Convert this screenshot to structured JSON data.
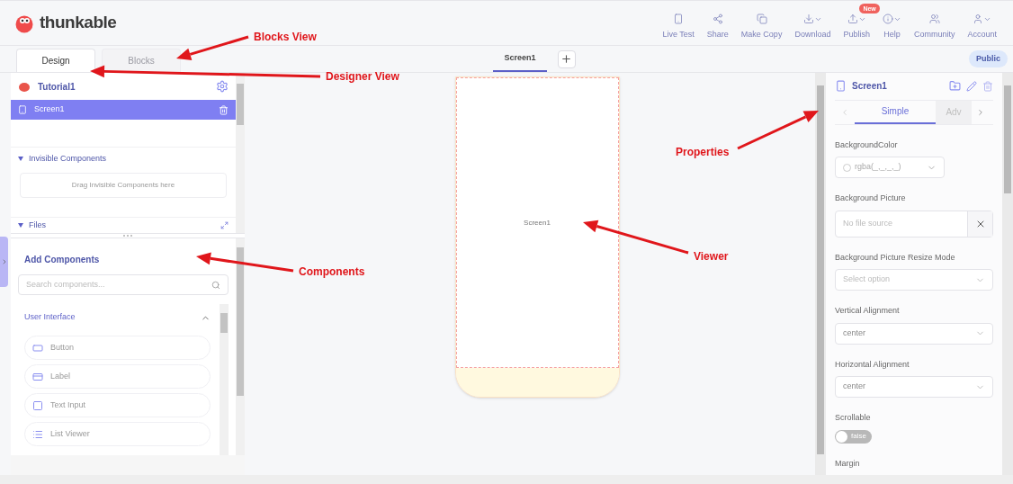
{
  "app": {
    "logo_text": "thunkable"
  },
  "toolbar": [
    {
      "label": "Live Test",
      "has_menu": false
    },
    {
      "label": "Share",
      "has_menu": false
    },
    {
      "label": "Make Copy",
      "has_menu": false
    },
    {
      "label": "Download",
      "has_menu": true
    },
    {
      "label": "Publish",
      "has_menu": true,
      "badge": "New"
    },
    {
      "label": "Help",
      "has_menu": true
    },
    {
      "label": "Community",
      "has_menu": false
    },
    {
      "label": "Account",
      "has_menu": true
    }
  ],
  "view_tabs": [
    {
      "label": "Design",
      "selected": true
    },
    {
      "label": "Blocks",
      "selected": false
    }
  ],
  "screen_tabs": [
    {
      "label": "Screen1",
      "selected": true
    }
  ],
  "visibility": "Public",
  "project": {
    "name": "Tutorial1"
  },
  "screens": [
    {
      "label": "Screen1",
      "selected": true
    }
  ],
  "invisible_components": {
    "title": "Invisible Components",
    "expanded": true,
    "hint": "Drag Invisible Components here"
  },
  "files": {
    "title": "Files",
    "expanded": true
  },
  "add_components": {
    "title": "Add Components",
    "search_placeholder": "Search components...",
    "category": {
      "title": "User Interface",
      "expanded": true
    },
    "items": [
      {
        "label": "Button"
      },
      {
        "label": "Label"
      },
      {
        "label": "Text Input"
      },
      {
        "label": "List Viewer"
      }
    ]
  },
  "viewer": {
    "label": "Screen1"
  },
  "properties": {
    "title": "Screen1",
    "tabs": [
      {
        "label": "Simple",
        "selected": true
      },
      {
        "label": "Adv",
        "selected": false
      }
    ],
    "fields": [
      {
        "kind": "color",
        "label": "BackgroundColor",
        "value": "rgba(_,_,_,_)"
      },
      {
        "kind": "file",
        "label": "Background Picture",
        "placeholder": "No file source"
      },
      {
        "kind": "select",
        "label": "Background Picture Resize Mode",
        "placeholder": "Select option"
      },
      {
        "kind": "select",
        "label": "Vertical Alignment",
        "value": "center"
      },
      {
        "kind": "select",
        "label": "Horizontal Alignment",
        "value": "center"
      },
      {
        "kind": "toggle",
        "label": "Scrollable",
        "on": false,
        "value": "false"
      },
      {
        "kind": "heading",
        "label": "Margin"
      }
    ]
  },
  "annotations": [
    {
      "label": "Blocks View"
    },
    {
      "label": "Designer View"
    },
    {
      "label": "Properties"
    },
    {
      "label": "Viewer"
    },
    {
      "label": "Components"
    }
  ]
}
